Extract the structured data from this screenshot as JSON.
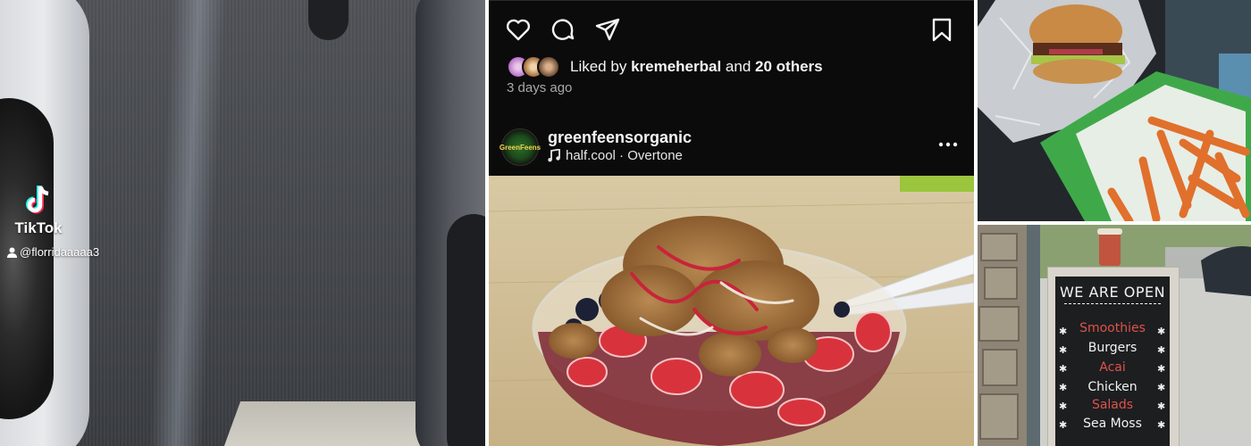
{
  "tiktok": {
    "wordmark": "TikTok",
    "username": "@florridaaaaa3",
    "logo_icon": "tiktok-logo-icon",
    "user_icon": "person-icon"
  },
  "instagram": {
    "actions": [
      "heart-icon",
      "comment-icon",
      "share-icon",
      "bookmark-icon"
    ],
    "liked_prefix": "Liked by",
    "liked_user": "kremeherbal",
    "liked_joiner": "and",
    "liked_others": "20 others",
    "time_ago": "3 days ago",
    "post": {
      "username": "greenfeensorganic",
      "avatar_text": "GreenFeens",
      "audio": "half.cool · Overtone",
      "audio_icon": "music-note-icon",
      "more_icon": "more-options-icon"
    }
  },
  "sign": {
    "headline": "WE ARE OPEN",
    "items": [
      "Smoothies",
      "Burgers",
      "Acai",
      "Chicken",
      "Salads",
      "Sea Moss"
    ]
  },
  "colors": {
    "ig_background": "#0b0b0c",
    "ig_text": "#f5f5f5",
    "ig_secondary": "#a8a8a8",
    "chalk_red": "#e0524a",
    "chalk_white": "#f2f2f2"
  }
}
